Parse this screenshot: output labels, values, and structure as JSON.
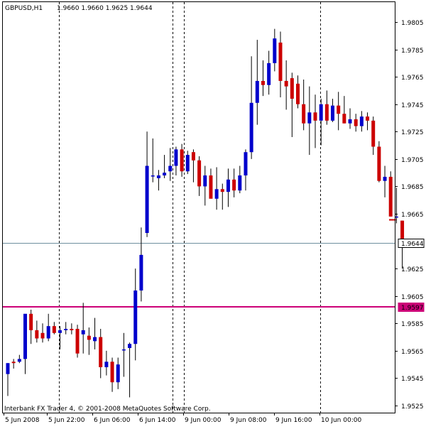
{
  "header": {
    "symbol_timeframe": "GBPUSD,H1",
    "ohlc": "1.9660 1.9660 1.9625 1.9644"
  },
  "footer": {
    "copyright": "Interbank FX Trader 4, © 2001-2008 MetaQuotes Software Corp."
  },
  "colors": {
    "bull": "#0000cc",
    "bear": "#cc0000",
    "background": "#ffffff",
    "grid": "#000000",
    "bid_line": "#6f8f9f",
    "magenta_line": "#cc0077",
    "short_red_line": "#cc0000"
  },
  "chart_data": {
    "type": "candlestick",
    "symbol": "GBPUSD",
    "timeframe": "H1",
    "ylim": [
      1.952,
      1.9812
    ],
    "y_ticks": [
      "1.9805",
      "1.9785",
      "1.9765",
      "1.9745",
      "1.9725",
      "1.9705",
      "1.9685",
      "1.9665",
      "1.9644",
      "1.9625",
      "1.9605",
      "1.9597",
      "1.9585",
      "1.9565",
      "1.9545",
      "1.9525"
    ],
    "x_ticks": [
      "5 Jun 2008",
      "5 Jun 22:00",
      "6 Jun 06:00",
      "6 Jun 14:00",
      "9 Jun 00:00",
      "9 Jun 08:00",
      "9 Jun 16:00",
      "10 Jun 00:00"
    ],
    "separators": [
      "5 Jun 22:00",
      "6 Jun 14:00",
      "9 Jun 00:00",
      "10 Jun 00:00"
    ],
    "current_price": 1.9644,
    "horizontal_level": 1.9597,
    "short_level": 1.9661,
    "candles": [
      {
        "o": 1.9548,
        "h": 1.9556,
        "l": 1.9532,
        "c": 1.9556
      },
      {
        "o": 1.9557,
        "h": 1.9559,
        "l": 1.9552,
        "c": 1.9556
      },
      {
        "o": 1.9557,
        "h": 1.9562,
        "l": 1.9556,
        "c": 1.9559
      },
      {
        "o": 1.9559,
        "h": 1.9586,
        "l": 1.9548,
        "c": 1.9592
      },
      {
        "o": 1.9592,
        "h": 1.9595,
        "l": 1.957,
        "c": 1.958
      },
      {
        "o": 1.958,
        "h": 1.9587,
        "l": 1.9571,
        "c": 1.9574
      },
      {
        "o": 1.9578,
        "h": 1.9585,
        "l": 1.9571,
        "c": 1.9574
      },
      {
        "o": 1.9574,
        "h": 1.9592,
        "l": 1.9572,
        "c": 1.9583
      },
      {
        "o": 1.9583,
        "h": 1.9586,
        "l": 1.9577,
        "c": 1.9578
      },
      {
        "o": 1.9578,
        "h": 1.9583,
        "l": 1.9566,
        "c": 1.958
      },
      {
        "o": 1.958,
        "h": 1.9586,
        "l": 1.9577,
        "c": 1.9581
      },
      {
        "o": 1.9581,
        "h": 1.9585,
        "l": 1.9577,
        "c": 1.958
      },
      {
        "o": 1.9581,
        "h": 1.9584,
        "l": 1.956,
        "c": 1.9563
      },
      {
        "o": 1.9577,
        "h": 1.96,
        "l": 1.9563,
        "c": 1.958
      },
      {
        "o": 1.9576,
        "h": 1.9582,
        "l": 1.9562,
        "c": 1.9573
      },
      {
        "o": 1.9572,
        "h": 1.9589,
        "l": 1.9566,
        "c": 1.9575
      },
      {
        "o": 1.9575,
        "h": 1.9581,
        "l": 1.9545,
        "c": 1.9553
      },
      {
        "o": 1.9553,
        "h": 1.9565,
        "l": 1.9547,
        "c": 1.9557
      },
      {
        "o": 1.9557,
        "h": 1.956,
        "l": 1.9535,
        "c": 1.9542
      },
      {
        "o": 1.9542,
        "h": 1.956,
        "l": 1.9537,
        "c": 1.9555
      },
      {
        "o": 1.9566,
        "h": 1.9578,
        "l": 1.9546,
        "c": 1.9566
      },
      {
        "o": 1.9567,
        "h": 1.9571,
        "l": 1.9531,
        "c": 1.957
      },
      {
        "o": 1.957,
        "h": 1.9625,
        "l": 1.9558,
        "c": 1.9609
      },
      {
        "o": 1.9609,
        "h": 1.9655,
        "l": 1.9601,
        "c": 1.9635
      },
      {
        "o": 1.9651,
        "h": 1.9725,
        "l": 1.9648,
        "c": 1.97
      },
      {
        "o": 1.9693,
        "h": 1.972,
        "l": 1.9688,
        "c": 1.9693
      },
      {
        "o": 1.9691,
        "h": 1.9697,
        "l": 1.9682,
        "c": 1.9693
      },
      {
        "o": 1.9693,
        "h": 1.9708,
        "l": 1.9691,
        "c": 1.9695
      },
      {
        "o": 1.9696,
        "h": 1.9713,
        "l": 1.9689,
        "c": 1.97
      },
      {
        "o": 1.97,
        "h": 1.9714,
        "l": 1.9693,
        "c": 1.9712
      },
      {
        "o": 1.9712,
        "h": 1.9716,
        "l": 1.9692,
        "c": 1.9696
      },
      {
        "o": 1.9696,
        "h": 1.9711,
        "l": 1.9694,
        "c": 1.9708
      },
      {
        "o": 1.971,
        "h": 1.9712,
        "l": 1.9688,
        "c": 1.9704
      },
      {
        "o": 1.9704,
        "h": 1.9707,
        "l": 1.9678,
        "c": 1.9685
      },
      {
        "o": 1.9685,
        "h": 1.97,
        "l": 1.9671,
        "c": 1.9693
      },
      {
        "o": 1.9693,
        "h": 1.9698,
        "l": 1.968,
        "c": 1.9676
      },
      {
        "o": 1.9676,
        "h": 1.9699,
        "l": 1.9668,
        "c": 1.9683
      },
      {
        "o": 1.9683,
        "h": 1.9687,
        "l": 1.9668,
        "c": 1.9681
      },
      {
        "o": 1.9681,
        "h": 1.9698,
        "l": 1.967,
        "c": 1.969
      },
      {
        "o": 1.969,
        "h": 1.9698,
        "l": 1.9677,
        "c": 1.9682
      },
      {
        "o": 1.9682,
        "h": 1.97,
        "l": 1.968,
        "c": 1.9693
      },
      {
        "o": 1.9693,
        "h": 1.9712,
        "l": 1.9682,
        "c": 1.971
      },
      {
        "o": 1.971,
        "h": 1.978,
        "l": 1.9705,
        "c": 1.9746
      },
      {
        "o": 1.9746,
        "h": 1.9792,
        "l": 1.973,
        "c": 1.9762
      },
      {
        "o": 1.9762,
        "h": 1.9777,
        "l": 1.9751,
        "c": 1.9759
      },
      {
        "o": 1.9759,
        "h": 1.9784,
        "l": 1.9752,
        "c": 1.9775
      },
      {
        "o": 1.9775,
        "h": 1.98,
        "l": 1.9769,
        "c": 1.9793
      },
      {
        "o": 1.979,
        "h": 1.9798,
        "l": 1.975,
        "c": 1.9762
      },
      {
        "o": 1.9762,
        "h": 1.9777,
        "l": 1.9741,
        "c": 1.9758
      },
      {
        "o": 1.9764,
        "h": 1.9768,
        "l": 1.9721,
        "c": 1.9749
      },
      {
        "o": 1.976,
        "h": 1.9766,
        "l": 1.9742,
        "c": 1.9745
      },
      {
        "o": 1.9745,
        "h": 1.9763,
        "l": 1.9726,
        "c": 1.9731
      },
      {
        "o": 1.9731,
        "h": 1.9758,
        "l": 1.9708,
        "c": 1.9739
      },
      {
        "o": 1.9739,
        "h": 1.9752,
        "l": 1.9713,
        "c": 1.9733
      },
      {
        "o": 1.9733,
        "h": 1.9749,
        "l": 1.9715,
        "c": 1.9745
      },
      {
        "o": 1.9745,
        "h": 1.9755,
        "l": 1.973,
        "c": 1.9733
      },
      {
        "o": 1.9733,
        "h": 1.9749,
        "l": 1.9732,
        "c": 1.9744
      },
      {
        "o": 1.9744,
        "h": 1.9754,
        "l": 1.9726,
        "c": 1.9738
      },
      {
        "o": 1.9738,
        "h": 1.9751,
        "l": 1.9731,
        "c": 1.9731
      },
      {
        "o": 1.9731,
        "h": 1.9742,
        "l": 1.9727,
        "c": 1.9734
      },
      {
        "o": 1.9734,
        "h": 1.9738,
        "l": 1.9725,
        "c": 1.9729
      },
      {
        "o": 1.9729,
        "h": 1.974,
        "l": 1.9725,
        "c": 1.9736
      },
      {
        "o": 1.9736,
        "h": 1.9739,
        "l": 1.9726,
        "c": 1.9733
      },
      {
        "o": 1.9733,
        "h": 1.9736,
        "l": 1.9708,
        "c": 1.9714
      },
      {
        "o": 1.9714,
        "h": 1.9718,
        "l": 1.9688,
        "c": 1.9689
      },
      {
        "o": 1.9689,
        "h": 1.97,
        "l": 1.9677,
        "c": 1.9692
      },
      {
        "o": 1.9692,
        "h": 1.9696,
        "l": 1.9663,
        "c": 1.9663
      },
      {
        "o": 1.9663,
        "h": 1.9684,
        "l": 1.9658,
        "c": 1.9663
      },
      {
        "o": 1.966,
        "h": 1.966,
        "l": 1.9625,
        "c": 1.9644
      }
    ]
  }
}
